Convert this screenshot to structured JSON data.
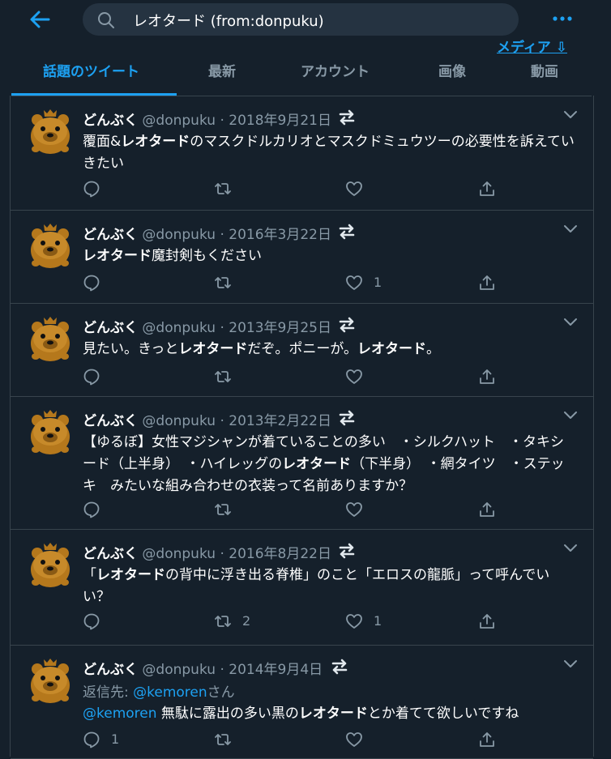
{
  "search": {
    "query": "レオタード (from:donpuku)"
  },
  "header": {
    "media_link": "メディア ⇩"
  },
  "tabs": [
    {
      "label": "話題のツイート"
    },
    {
      "label": "最新"
    },
    {
      "label": "アカウント"
    },
    {
      "label": "画像"
    },
    {
      "label": "動画"
    }
  ],
  "colors": {
    "background": "#15202b",
    "accent": "#1da1f2",
    "muted": "#8899a6",
    "border": "#38444d",
    "search_bg": "#253341"
  },
  "tweets": [
    {
      "name": "どんぶく",
      "handle": "@donpuku",
      "dot": "·",
      "date": "2018年9月21日",
      "segments": [
        {
          "t": "覆面&"
        },
        {
          "t": "レオタード",
          "b": true
        },
        {
          "t": "のマスクドルカリオとマスクドミュウツーの必要性を訴えていきたい"
        }
      ],
      "reply_count": "",
      "retweet_count": "",
      "like_count": ""
    },
    {
      "name": "どんぶく",
      "handle": "@donpuku",
      "dot": "·",
      "date": "2016年3月22日",
      "segments": [
        {
          "t": "レオタード",
          "b": true
        },
        {
          "t": "魔封剣もください"
        }
      ],
      "reply_count": "",
      "retweet_count": "",
      "like_count": "1"
    },
    {
      "name": "どんぶく",
      "handle": "@donpuku",
      "dot": "·",
      "date": "2013年9月25日",
      "segments": [
        {
          "t": "見たい。きっと"
        },
        {
          "t": "レオタード",
          "b": true
        },
        {
          "t": "だぞ。ポニーが。"
        },
        {
          "t": "レオタード",
          "b": true
        },
        {
          "t": "。"
        }
      ],
      "reply_count": "",
      "retweet_count": "",
      "like_count": ""
    },
    {
      "name": "どんぶく",
      "handle": "@donpuku",
      "dot": "·",
      "date": "2013年2月22日",
      "segments": [
        {
          "t": "【ゆるぼ】女性マジシャンが着ていることの多い　・シルクハット　・タキシード（上半身）　・ハイレッグの"
        },
        {
          "t": "レオタード",
          "b": true
        },
        {
          "t": "（下半身）　・網タイツ　・ステッキ　みたいな組み合わせの衣装って名前ありますか？"
        }
      ],
      "reply_count": "",
      "retweet_count": "",
      "like_count": ""
    },
    {
      "name": "どんぶく",
      "handle": "@donpuku",
      "dot": "·",
      "date": "2016年8月22日",
      "segments": [
        {
          "t": "「"
        },
        {
          "t": "レオタード",
          "b": true
        },
        {
          "t": "の背中に浮き出る脊椎」のこと「エロスの龍脈」って呼んでいい？"
        }
      ],
      "reply_count": "",
      "retweet_count": "2",
      "like_count": "1"
    },
    {
      "name": "どんぶく",
      "handle": "@donpuku",
      "dot": "·",
      "date": "2014年9月4日",
      "reply_prefix": "返信先: ",
      "reply_to": "@kemoren",
      "reply_suffix": "さん",
      "segments": [
        {
          "t": "@kemoren",
          "m": true
        },
        {
          "t": " 無駄に露出の多い黒の"
        },
        {
          "t": "レオタード",
          "b": true
        },
        {
          "t": "とか着てて欲しいですね"
        }
      ],
      "reply_count": "1",
      "retweet_count": "",
      "like_count": ""
    }
  ]
}
